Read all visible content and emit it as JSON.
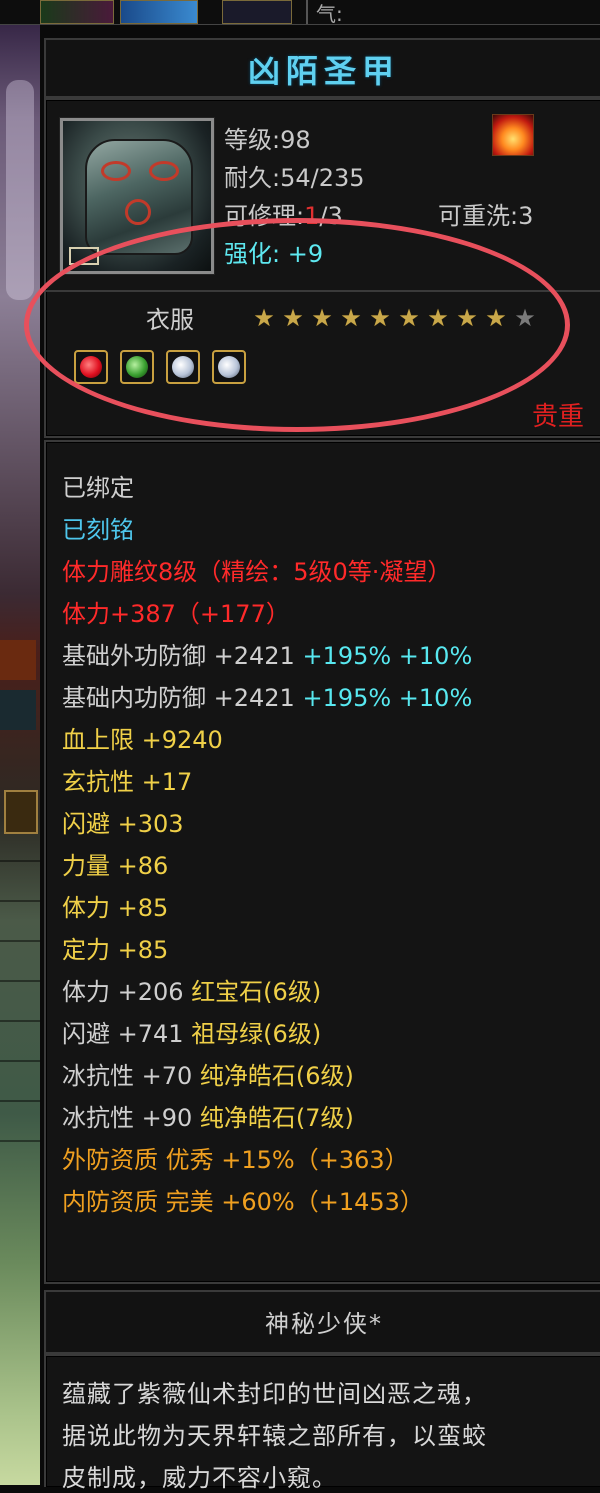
{
  "top_bar": {
    "qi_label": "气:"
  },
  "item": {
    "name": "凶陌圣甲",
    "level_text": "等级:98",
    "durability_text": "耐久:54/235",
    "repair_label": "可修理:",
    "repair_current": "1",
    "repair_max": "/3",
    "rewash_text": "可重洗:3",
    "enhance_label": "强化:",
    "enhance_value": "+9"
  },
  "slot": {
    "label": "衣服",
    "stars_filled": 9,
    "stars_total": 10,
    "gems": [
      {
        "icon": "red-gem-icon"
      },
      {
        "icon": "green-gem-icon"
      },
      {
        "icon": "white-gem-icon"
      },
      {
        "icon": "white-gem-icon"
      }
    ],
    "rarity": "贵重"
  },
  "attributes": [
    {
      "parts": [
        {
          "text": "已绑定",
          "color": "white"
        }
      ]
    },
    {
      "parts": [
        {
          "text": "已刻铭",
          "color": "cyan"
        }
      ]
    },
    {
      "parts": [
        {
          "text": "体力雕纹8级（精绘：5级0等·凝望）",
          "color": "red"
        }
      ]
    },
    {
      "parts": [
        {
          "text": "体力+387（+177）",
          "color": "red"
        }
      ]
    },
    {
      "parts": [
        {
          "text": "基础外功防御 +2421 ",
          "color": "white"
        },
        {
          "text": "+195% +10%",
          "color": "lightcyan"
        }
      ]
    },
    {
      "parts": [
        {
          "text": "基础内功防御 +2421 ",
          "color": "white"
        },
        {
          "text": "+195% +10%",
          "color": "lightcyan"
        }
      ]
    },
    {
      "parts": [
        {
          "text": "血上限 +9240",
          "color": "yellow"
        }
      ]
    },
    {
      "parts": [
        {
          "text": "玄抗性 +17",
          "color": "yellow"
        }
      ]
    },
    {
      "parts": [
        {
          "text": "闪避 +303",
          "color": "yellow"
        }
      ]
    },
    {
      "parts": [
        {
          "text": "力量 +86",
          "color": "yellow"
        }
      ]
    },
    {
      "parts": [
        {
          "text": "体力 +85",
          "color": "yellow"
        }
      ]
    },
    {
      "parts": [
        {
          "text": "定力 +85",
          "color": "yellow"
        }
      ]
    },
    {
      "parts": [
        {
          "text": "体力 +206 ",
          "color": "white"
        },
        {
          "text": "红宝石(6级)",
          "color": "yellow"
        }
      ]
    },
    {
      "parts": [
        {
          "text": "闪避 +741 ",
          "color": "white"
        },
        {
          "text": "祖母绿(6级)",
          "color": "yellow"
        }
      ]
    },
    {
      "parts": [
        {
          "text": "冰抗性 +70 ",
          "color": "white"
        },
        {
          "text": "纯净皓石(6级)",
          "color": "yellow"
        }
      ]
    },
    {
      "parts": [
        {
          "text": "冰抗性 +90 ",
          "color": "white"
        },
        {
          "text": "纯净皓石(7级)",
          "color": "yellow"
        }
      ]
    },
    {
      "parts": [
        {
          "text": "外防资质  优秀 +15%（+363）",
          "color": "orange"
        }
      ]
    },
    {
      "parts": [
        {
          "text": "内防资质  完美 +60%（+1453）",
          "color": "orange"
        }
      ]
    }
  ],
  "description": {
    "title": "神秘少侠*",
    "lines": [
      "蕴藏了紫薇仙术封印的世间凶恶之魂，",
      "据说此物为天界轩辕之部所有，以蛮蛟",
      "皮制成，威力不容小窥。"
    ]
  },
  "colors": {
    "white": "#cfcfcf",
    "cyan": "#4ec6ec",
    "red": "#ff2a2a",
    "yellow": "#f0d048",
    "orange": "#f0a020",
    "lightcyan": "#58e8f0",
    "title": "#5fd0f0",
    "rarity": "#e02020"
  }
}
